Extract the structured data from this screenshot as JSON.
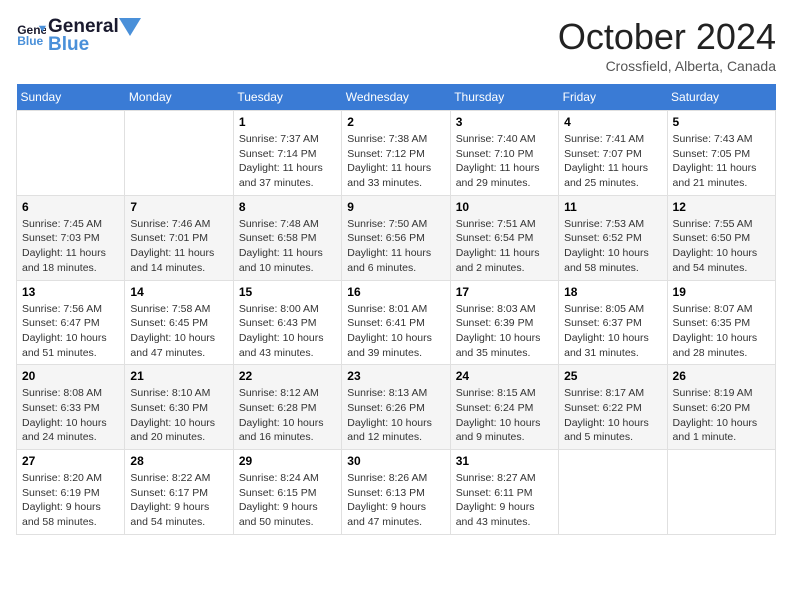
{
  "logo": {
    "line1": "General",
    "line2": "Blue"
  },
  "title": "October 2024",
  "location": "Crossfield, Alberta, Canada",
  "days_of_week": [
    "Sunday",
    "Monday",
    "Tuesday",
    "Wednesday",
    "Thursday",
    "Friday",
    "Saturday"
  ],
  "weeks": [
    [
      {
        "day": "",
        "detail": ""
      },
      {
        "day": "",
        "detail": ""
      },
      {
        "day": "1",
        "detail": "Sunrise: 7:37 AM\nSunset: 7:14 PM\nDaylight: 11 hours\nand 37 minutes."
      },
      {
        "day": "2",
        "detail": "Sunrise: 7:38 AM\nSunset: 7:12 PM\nDaylight: 11 hours\nand 33 minutes."
      },
      {
        "day": "3",
        "detail": "Sunrise: 7:40 AM\nSunset: 7:10 PM\nDaylight: 11 hours\nand 29 minutes."
      },
      {
        "day": "4",
        "detail": "Sunrise: 7:41 AM\nSunset: 7:07 PM\nDaylight: 11 hours\nand 25 minutes."
      },
      {
        "day": "5",
        "detail": "Sunrise: 7:43 AM\nSunset: 7:05 PM\nDaylight: 11 hours\nand 21 minutes."
      }
    ],
    [
      {
        "day": "6",
        "detail": "Sunrise: 7:45 AM\nSunset: 7:03 PM\nDaylight: 11 hours\nand 18 minutes."
      },
      {
        "day": "7",
        "detail": "Sunrise: 7:46 AM\nSunset: 7:01 PM\nDaylight: 11 hours\nand 14 minutes."
      },
      {
        "day": "8",
        "detail": "Sunrise: 7:48 AM\nSunset: 6:58 PM\nDaylight: 11 hours\nand 10 minutes."
      },
      {
        "day": "9",
        "detail": "Sunrise: 7:50 AM\nSunset: 6:56 PM\nDaylight: 11 hours\nand 6 minutes."
      },
      {
        "day": "10",
        "detail": "Sunrise: 7:51 AM\nSunset: 6:54 PM\nDaylight: 11 hours\nand 2 minutes."
      },
      {
        "day": "11",
        "detail": "Sunrise: 7:53 AM\nSunset: 6:52 PM\nDaylight: 10 hours\nand 58 minutes."
      },
      {
        "day": "12",
        "detail": "Sunrise: 7:55 AM\nSunset: 6:50 PM\nDaylight: 10 hours\nand 54 minutes."
      }
    ],
    [
      {
        "day": "13",
        "detail": "Sunrise: 7:56 AM\nSunset: 6:47 PM\nDaylight: 10 hours\nand 51 minutes."
      },
      {
        "day": "14",
        "detail": "Sunrise: 7:58 AM\nSunset: 6:45 PM\nDaylight: 10 hours\nand 47 minutes."
      },
      {
        "day": "15",
        "detail": "Sunrise: 8:00 AM\nSunset: 6:43 PM\nDaylight: 10 hours\nand 43 minutes."
      },
      {
        "day": "16",
        "detail": "Sunrise: 8:01 AM\nSunset: 6:41 PM\nDaylight: 10 hours\nand 39 minutes."
      },
      {
        "day": "17",
        "detail": "Sunrise: 8:03 AM\nSunset: 6:39 PM\nDaylight: 10 hours\nand 35 minutes."
      },
      {
        "day": "18",
        "detail": "Sunrise: 8:05 AM\nSunset: 6:37 PM\nDaylight: 10 hours\nand 31 minutes."
      },
      {
        "day": "19",
        "detail": "Sunrise: 8:07 AM\nSunset: 6:35 PM\nDaylight: 10 hours\nand 28 minutes."
      }
    ],
    [
      {
        "day": "20",
        "detail": "Sunrise: 8:08 AM\nSunset: 6:33 PM\nDaylight: 10 hours\nand 24 minutes."
      },
      {
        "day": "21",
        "detail": "Sunrise: 8:10 AM\nSunset: 6:30 PM\nDaylight: 10 hours\nand 20 minutes."
      },
      {
        "day": "22",
        "detail": "Sunrise: 8:12 AM\nSunset: 6:28 PM\nDaylight: 10 hours\nand 16 minutes."
      },
      {
        "day": "23",
        "detail": "Sunrise: 8:13 AM\nSunset: 6:26 PM\nDaylight: 10 hours\nand 12 minutes."
      },
      {
        "day": "24",
        "detail": "Sunrise: 8:15 AM\nSunset: 6:24 PM\nDaylight: 10 hours\nand 9 minutes."
      },
      {
        "day": "25",
        "detail": "Sunrise: 8:17 AM\nSunset: 6:22 PM\nDaylight: 10 hours\nand 5 minutes."
      },
      {
        "day": "26",
        "detail": "Sunrise: 8:19 AM\nSunset: 6:20 PM\nDaylight: 10 hours\nand 1 minute."
      }
    ],
    [
      {
        "day": "27",
        "detail": "Sunrise: 8:20 AM\nSunset: 6:19 PM\nDaylight: 9 hours\nand 58 minutes."
      },
      {
        "day": "28",
        "detail": "Sunrise: 8:22 AM\nSunset: 6:17 PM\nDaylight: 9 hours\nand 54 minutes."
      },
      {
        "day": "29",
        "detail": "Sunrise: 8:24 AM\nSunset: 6:15 PM\nDaylight: 9 hours\nand 50 minutes."
      },
      {
        "day": "30",
        "detail": "Sunrise: 8:26 AM\nSunset: 6:13 PM\nDaylight: 9 hours\nand 47 minutes."
      },
      {
        "day": "31",
        "detail": "Sunrise: 8:27 AM\nSunset: 6:11 PM\nDaylight: 9 hours\nand 43 minutes."
      },
      {
        "day": "",
        "detail": ""
      },
      {
        "day": "",
        "detail": ""
      }
    ]
  ]
}
